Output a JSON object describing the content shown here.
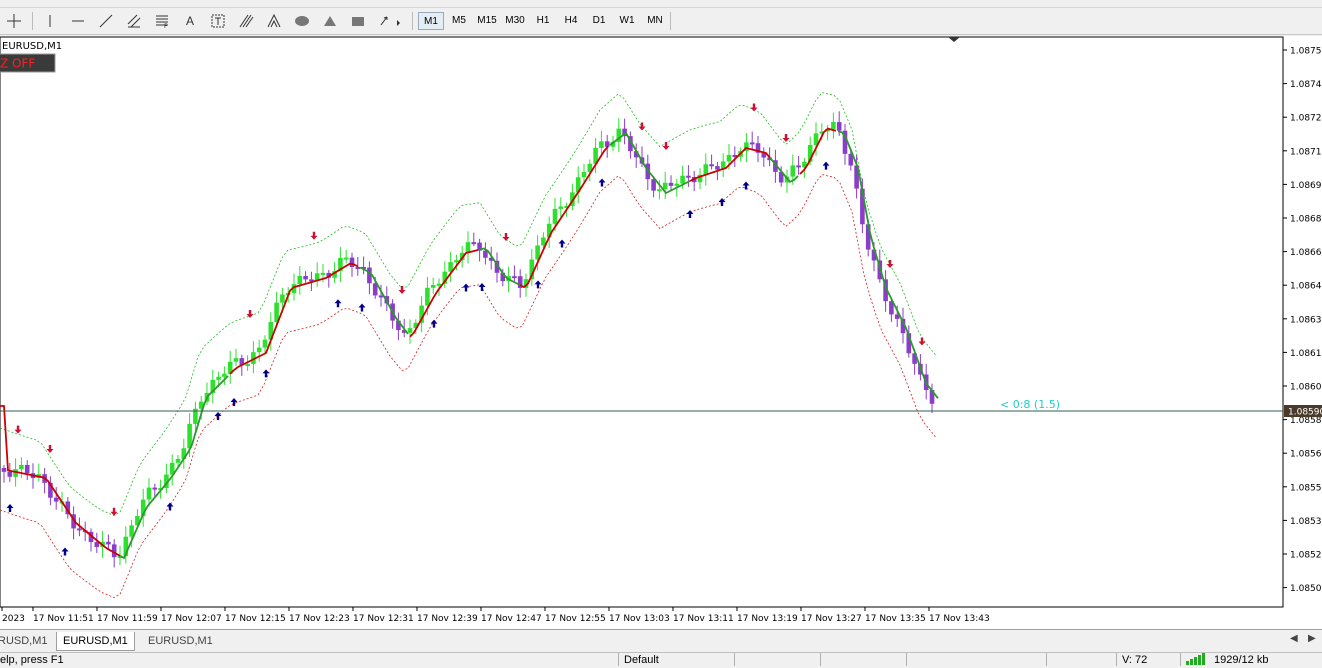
{
  "toolbar": {
    "timeframes": [
      "M1",
      "M5",
      "M15",
      "M30",
      "H1",
      "H4",
      "D1",
      "W1",
      "MN"
    ],
    "active_timeframe": "M1",
    "tools": [
      "crosshair-icon",
      "vertical-line-icon",
      "horizontal-line-icon",
      "trendline-icon",
      "channel-icon",
      "fibonacci-icon",
      "text-icon",
      "text-label-icon",
      "gann-icon",
      "cycle-lines-icon",
      "ellipse-icon",
      "triangle-icon",
      "rectangle-icon",
      "arrows-icon"
    ]
  },
  "chart": {
    "symbol_label": "EURUSD,M1",
    "button_label": "Z OFF",
    "price_labels": [
      "1.08755",
      "1.08740",
      "1.08725",
      "1.08710",
      "1.08695",
      "1.08680",
      "1.08660",
      "1.08645",
      "1.08630",
      "1.08615",
      "1.08600",
      "1.08580",
      "1.08565",
      "1.08550",
      "1.08535",
      "1.08520",
      "1.08505"
    ],
    "current_price": "1.08590",
    "annotation": "< 0:8 (1.5)",
    "time_labels": [
      "2023",
      "17 Nov 11:51",
      "17 Nov 11:59",
      "17 Nov 12:07",
      "17 Nov 12:15",
      "17 Nov 12:23",
      "17 Nov 12:31",
      "17 Nov 12:39",
      "17 Nov 12:47",
      "17 Nov 12:55",
      "17 Nov 13:03",
      "17 Nov 13:11",
      "17 Nov 13:19",
      "17 Nov 13:27",
      "17 Nov 13:35",
      "17 Nov 13:43"
    ],
    "colors": {
      "bull": "#2ee02e",
      "bear": "#8a3dc8",
      "ma_red": "#cc0000",
      "ma_green": "#2a9a2a",
      "band_green": "#22bb22",
      "band_red": "#cc2222",
      "arrow_up": "#00008b",
      "arrow_down": "#cc1133",
      "annotation": "#00cccc"
    }
  },
  "tabs": {
    "items": [
      "RUSD,M1",
      "EURUSD,M1",
      "EURUSD,M1"
    ],
    "active_index": 1
  },
  "status": {
    "help": "elp, press F1",
    "profile": "Default",
    "volume": "V: 72",
    "traffic": "1929/12 kb"
  }
}
